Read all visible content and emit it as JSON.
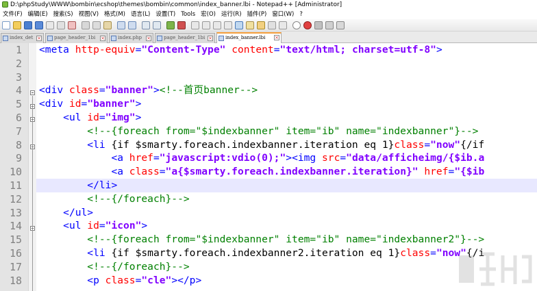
{
  "window": {
    "title": "D:\\phpStudy\\WWW\\bombin\\ecshop\\themes\\bombin\\common\\index_banner.lbi - Notepad++ [Administrator]"
  },
  "menu": [
    "文件(F)",
    "编辑(E)",
    "搜索(S)",
    "视图(V)",
    "格式(M)",
    "语言(L)",
    "设置(T)",
    "Tools",
    "宏(O)",
    "运行(R)",
    "插件(P)",
    "窗口(W)",
    "?"
  ],
  "tabs": [
    {
      "label": "index_det",
      "active": false
    },
    {
      "label": "page_header_1bi",
      "active": false
    },
    {
      "label": "index.php",
      "active": false
    },
    {
      "label": "page_header_1bi",
      "active": false
    },
    {
      "label": "index_banner.lbi",
      "active": true
    }
  ],
  "editor": {
    "current_line": 11,
    "lines": [
      {
        "num": "1",
        "tokens": [
          [
            "t",
            "<meta "
          ],
          [
            "a",
            "http-equiv"
          ],
          [
            "t",
            "="
          ],
          [
            "v",
            "\"Content-Type\""
          ],
          [
            "t",
            " "
          ],
          [
            "a",
            "content"
          ],
          [
            "t",
            "="
          ],
          [
            "v",
            "\"text/html; charset=utf-8\""
          ],
          [
            "t",
            ">"
          ]
        ]
      },
      {
        "num": "2",
        "tokens": []
      },
      {
        "num": "3",
        "tokens": []
      },
      {
        "num": "4",
        "tokens": [
          [
            "t",
            "<div "
          ],
          [
            "a",
            "class"
          ],
          [
            "t",
            "="
          ],
          [
            "v",
            "\"banner\""
          ],
          [
            "t",
            ">"
          ],
          [
            "c",
            "<!--首页banner-->"
          ]
        ]
      },
      {
        "num": "5",
        "tokens": [
          [
            "t",
            "<div "
          ],
          [
            "a",
            "id"
          ],
          [
            "t",
            "="
          ],
          [
            "v",
            "\"banner\""
          ],
          [
            "t",
            ">"
          ]
        ]
      },
      {
        "num": "6",
        "tokens": [
          [
            "p",
            "    "
          ],
          [
            "t",
            "<ul "
          ],
          [
            "a",
            "id"
          ],
          [
            "t",
            "="
          ],
          [
            "v",
            "\"img\""
          ],
          [
            "t",
            ">"
          ]
        ]
      },
      {
        "num": "7",
        "tokens": [
          [
            "p",
            "        "
          ],
          [
            "c",
            "<!--{foreach from=\"$indexbanner\" item=\"ib\" name=\"indexbanner\"}-->"
          ]
        ]
      },
      {
        "num": "8",
        "tokens": [
          [
            "p",
            "        "
          ],
          [
            "t",
            "<li "
          ],
          [
            "p",
            "{if $smarty.foreach.indexbanner.iteration eq 1}"
          ],
          [
            "a",
            "class"
          ],
          [
            "t",
            "="
          ],
          [
            "v",
            "\"now\""
          ],
          [
            "p",
            "{/if"
          ]
        ]
      },
      {
        "num": "9",
        "tokens": [
          [
            "p",
            "            "
          ],
          [
            "t",
            "<a "
          ],
          [
            "a",
            "href"
          ],
          [
            "t",
            "="
          ],
          [
            "v",
            "\"javascript:vdio(0);\""
          ],
          [
            "t",
            ">"
          ],
          [
            "t",
            "<img "
          ],
          [
            "a",
            "src"
          ],
          [
            "t",
            "="
          ],
          [
            "v",
            "\"data/afficheimg/{$ib.a"
          ]
        ]
      },
      {
        "num": "10",
        "tokens": [
          [
            "p",
            "            "
          ],
          [
            "t",
            "<a "
          ],
          [
            "a",
            "class"
          ],
          [
            "t",
            "="
          ],
          [
            "v",
            "\"a{$smarty.foreach.indexbanner.iteration}\""
          ],
          [
            "t",
            " "
          ],
          [
            "a",
            "href"
          ],
          [
            "t",
            "="
          ],
          [
            "v",
            "\"{$ib"
          ]
        ]
      },
      {
        "num": "11",
        "tokens": [
          [
            "p",
            "        "
          ],
          [
            "t",
            "</li>"
          ]
        ]
      },
      {
        "num": "12",
        "tokens": [
          [
            "p",
            "        "
          ],
          [
            "c",
            "<!--{/foreach}-->"
          ]
        ]
      },
      {
        "num": "13",
        "tokens": [
          [
            "p",
            "    "
          ],
          [
            "t",
            "</ul>"
          ]
        ]
      },
      {
        "num": "14",
        "tokens": [
          [
            "p",
            "    "
          ],
          [
            "t",
            "<ul "
          ],
          [
            "a",
            "id"
          ],
          [
            "t",
            "="
          ],
          [
            "v",
            "\"icon\""
          ],
          [
            "t",
            ">"
          ]
        ]
      },
      {
        "num": "15",
        "tokens": [
          [
            "p",
            "        "
          ],
          [
            "c",
            "<!--{foreach from=\"$indexbanner\" item=\"ib\" name=\"indexbanner2\"}-->"
          ]
        ]
      },
      {
        "num": "16",
        "tokens": [
          [
            "p",
            "        "
          ],
          [
            "t",
            "<li "
          ],
          [
            "p",
            "{if $smarty.foreach.indexbanner2.iteration eq 1}"
          ],
          [
            "a",
            "class"
          ],
          [
            "t",
            "="
          ],
          [
            "v",
            "\"now\""
          ],
          [
            "p",
            "{/i"
          ]
        ]
      },
      {
        "num": "17",
        "tokens": [
          [
            "p",
            "        "
          ],
          [
            "c",
            "<!--{/foreach}-->"
          ]
        ]
      },
      {
        "num": "18",
        "tokens": [
          [
            "p",
            "        "
          ],
          [
            "t",
            "<p "
          ],
          [
            "a",
            "class"
          ],
          [
            "t",
            "="
          ],
          [
            "v",
            "\"cle\""
          ],
          [
            "t",
            "></p>"
          ]
        ]
      }
    ]
  },
  "colors": {
    "tag": "#0000ff",
    "attribute": "#ff0000",
    "value": "#8000ff",
    "comment": "#008000",
    "current_line_bg": "#e8e8ff",
    "active_tab_accent": "#f29c38"
  }
}
